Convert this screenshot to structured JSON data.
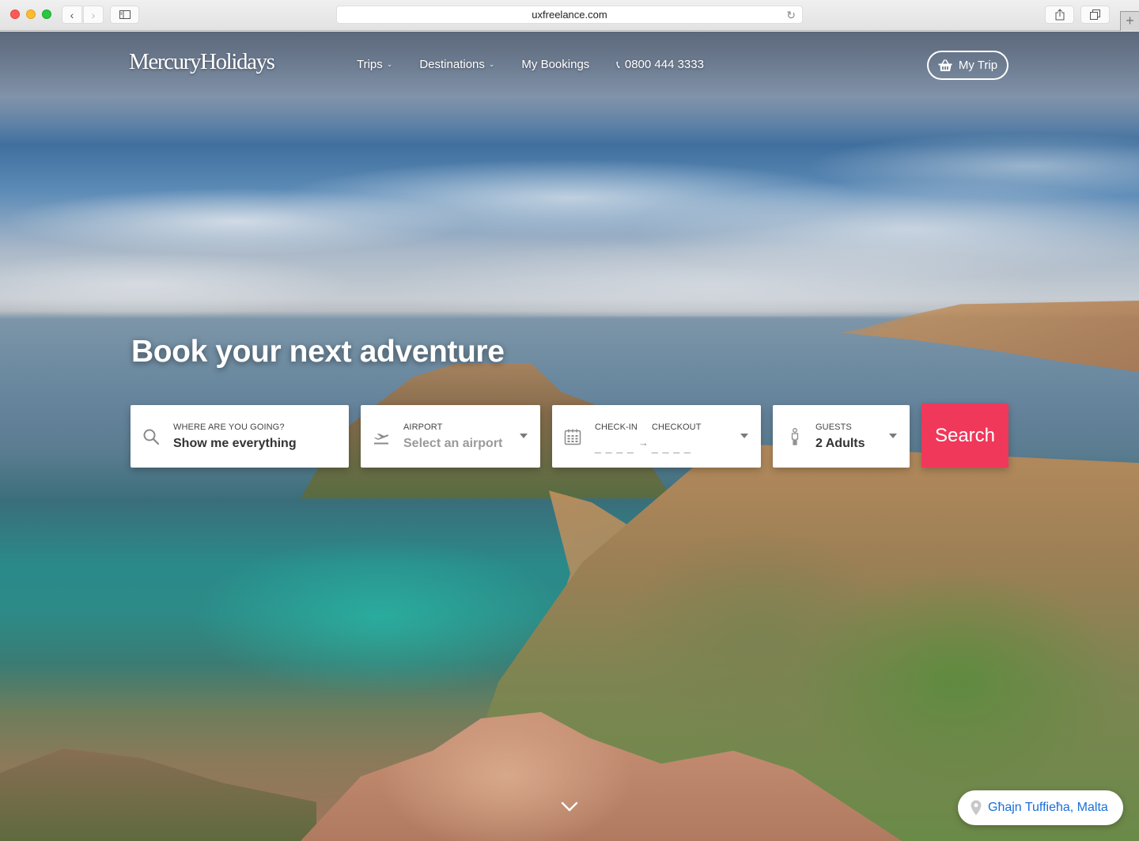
{
  "browser": {
    "url": "uxfreelance.com",
    "new_tab_label": "+"
  },
  "nav": {
    "logo": "MercuryHolidays",
    "items": [
      {
        "label": "Trips",
        "has_dropdown": true
      },
      {
        "label": "Destinations",
        "has_dropdown": true
      },
      {
        "label": "My Bookings",
        "has_dropdown": false
      }
    ],
    "phone": "0800 444 3333",
    "my_trip_label": "My Trip"
  },
  "hero": {
    "headline": "Book your next adventure",
    "location_caption": "Għajn Tuffieħa, Malta"
  },
  "search": {
    "destination": {
      "label": "WHERE ARE YOU GOING?",
      "value": "Show me everything"
    },
    "airport": {
      "label": "AIRPORT",
      "placeholder": "Select an airport"
    },
    "dates": {
      "checkin_label": "CHECK-IN",
      "checkout_label": "CHECKOUT",
      "checkin_placeholder": "_ _ _ _",
      "checkout_placeholder": "_ _ _ _",
      "arrow": "→"
    },
    "guests": {
      "label": "GUESTS",
      "value": "2 Adults"
    },
    "button_label": "Search"
  },
  "colors": {
    "search_button": "#f0385a",
    "location_text": "#1a6fd8"
  }
}
